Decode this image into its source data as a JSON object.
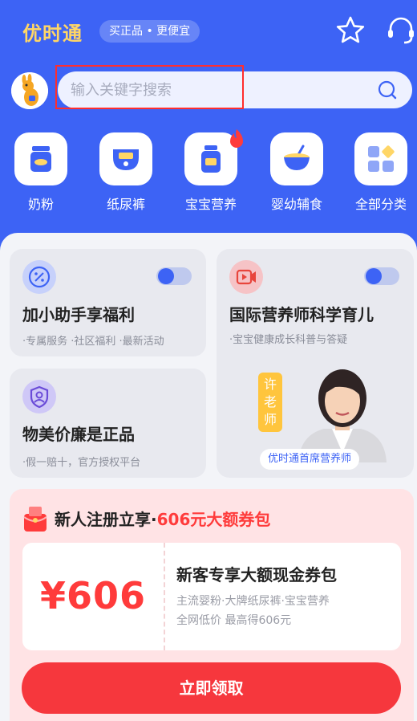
{
  "header": {
    "brand": "优时通",
    "slogan": "买正品 • 更便宜",
    "star_icon": "star-icon",
    "service_icon": "headset-icon"
  },
  "search": {
    "placeholder": "输入关键字搜索",
    "icon": "search-icon"
  },
  "categories": [
    {
      "label": "奶粉",
      "icon": "milk-can-icon"
    },
    {
      "label": "纸尿裤",
      "icon": "diaper-icon"
    },
    {
      "label": "宝宝营养",
      "icon": "supplement-bottle-icon"
    },
    {
      "label": "婴幼辅食",
      "icon": "baby-food-bowl-icon"
    },
    {
      "label": "全部分类",
      "icon": "grid-icon"
    }
  ],
  "cards": {
    "assistant": {
      "title": "加小助手享福利",
      "subtitle": "·专属服务 ·社区福利 ·最新活动",
      "icon": "discount-badge-icon"
    },
    "nutritionist": {
      "title": "国际营养师科学育儿",
      "subtitle": "·宝宝健康成长科普与答疑",
      "icon": "video-icon",
      "tag": "许\n老\n师",
      "caption": "优时通首席营养师"
    },
    "genuine": {
      "title": "物美价廉是正品",
      "subtitle": "·假一赔十，官方授权平台",
      "icon": "shield-user-icon"
    }
  },
  "promo": {
    "title_prefix": "新人注册立享·",
    "title_accent": "606元大额券包",
    "coupon_amount": "¥606",
    "coupon_title": "新客专享大额现金券包",
    "coupon_desc_1": "主流婴粉·大牌纸尿裤·宝宝营养",
    "coupon_desc_2": "全网低价 最高得606元",
    "button": "立即领取"
  },
  "colors": {
    "primary": "#3d63f5",
    "brand_yellow": "#ffd666",
    "accent_red": "#ff3b3b",
    "button_red": "#f6373d"
  }
}
